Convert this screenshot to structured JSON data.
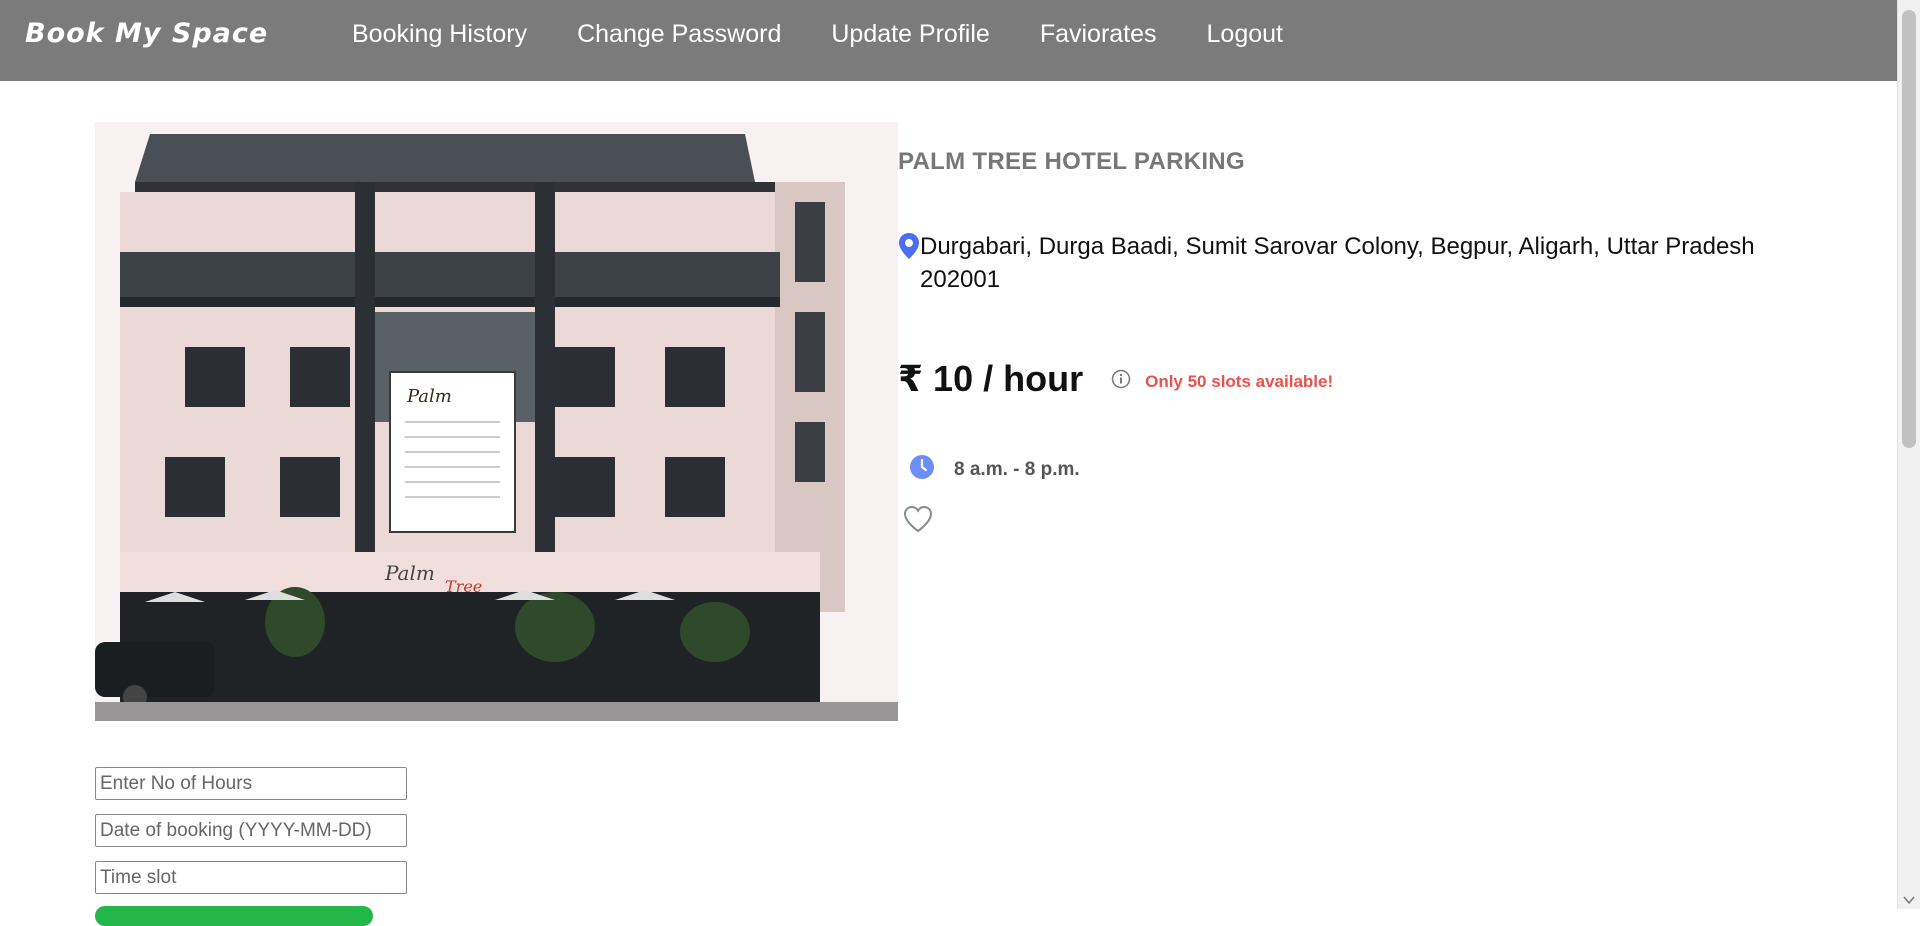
{
  "nav": {
    "brand": "Book My Space",
    "links": [
      "Booking History",
      "Change Password",
      "Update Profile",
      "Faviorates",
      "Logout"
    ]
  },
  "listing": {
    "title": "PALM TREE HOTEL PARKING",
    "address": "Durgabari, Durga Baadi, Sumit Sarovar Colony, Begpur, Aligarh, Uttar Pradesh 202001",
    "price": "₹ 10 / hour",
    "slots": "Only 50 slots available!",
    "hours": "8 a.m. - 8 p.m.",
    "image_signs": {
      "main": "Palm",
      "sub": "Tree"
    }
  },
  "form": {
    "hours_placeholder": "Enter No of Hours",
    "date_placeholder": "Date of booking (YYYY-MM-DD)",
    "time_placeholder": "Time slot"
  },
  "icons": {
    "pin": "location-pin-icon",
    "info": "info-icon",
    "clock": "clock-icon",
    "favorite": "heart-outline-icon"
  },
  "colors": {
    "navbar": "#7b7b7b",
    "pin": "#4c6ef5",
    "slots": "#e8524f",
    "clock": "#6d8ef7",
    "book_button": "#23b74a"
  }
}
